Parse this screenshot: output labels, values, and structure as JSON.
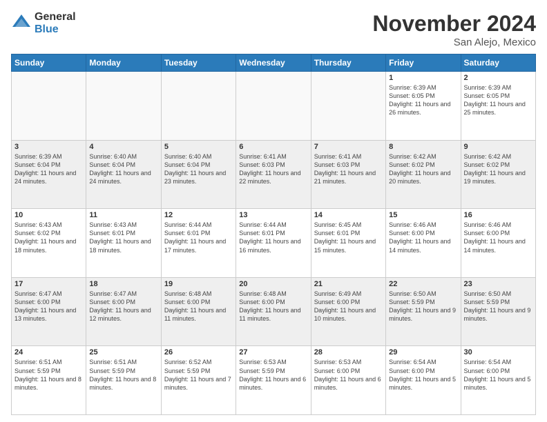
{
  "logo": {
    "general": "General",
    "blue": "Blue"
  },
  "title": {
    "month": "November 2024",
    "location": "San Alejo, Mexico"
  },
  "headers": [
    "Sunday",
    "Monday",
    "Tuesday",
    "Wednesday",
    "Thursday",
    "Friday",
    "Saturday"
  ],
  "weeks": [
    [
      {
        "day": "",
        "info": "",
        "empty": true
      },
      {
        "day": "",
        "info": "",
        "empty": true
      },
      {
        "day": "",
        "info": "",
        "empty": true
      },
      {
        "day": "",
        "info": "",
        "empty": true
      },
      {
        "day": "",
        "info": "",
        "empty": true
      },
      {
        "day": "1",
        "info": "Sunrise: 6:39 AM\nSunset: 6:05 PM\nDaylight: 11 hours\nand 26 minutes.",
        "empty": false
      },
      {
        "day": "2",
        "info": "Sunrise: 6:39 AM\nSunset: 6:05 PM\nDaylight: 11 hours\nand 25 minutes.",
        "empty": false
      }
    ],
    [
      {
        "day": "3",
        "info": "Sunrise: 6:39 AM\nSunset: 6:04 PM\nDaylight: 11 hours\nand 24 minutes.",
        "empty": false
      },
      {
        "day": "4",
        "info": "Sunrise: 6:40 AM\nSunset: 6:04 PM\nDaylight: 11 hours\nand 24 minutes.",
        "empty": false
      },
      {
        "day": "5",
        "info": "Sunrise: 6:40 AM\nSunset: 6:04 PM\nDaylight: 11 hours\nand 23 minutes.",
        "empty": false
      },
      {
        "day": "6",
        "info": "Sunrise: 6:41 AM\nSunset: 6:03 PM\nDaylight: 11 hours\nand 22 minutes.",
        "empty": false
      },
      {
        "day": "7",
        "info": "Sunrise: 6:41 AM\nSunset: 6:03 PM\nDaylight: 11 hours\nand 21 minutes.",
        "empty": false
      },
      {
        "day": "8",
        "info": "Sunrise: 6:42 AM\nSunset: 6:02 PM\nDaylight: 11 hours\nand 20 minutes.",
        "empty": false
      },
      {
        "day": "9",
        "info": "Sunrise: 6:42 AM\nSunset: 6:02 PM\nDaylight: 11 hours\nand 19 minutes.",
        "empty": false
      }
    ],
    [
      {
        "day": "10",
        "info": "Sunrise: 6:43 AM\nSunset: 6:02 PM\nDaylight: 11 hours\nand 18 minutes.",
        "empty": false
      },
      {
        "day": "11",
        "info": "Sunrise: 6:43 AM\nSunset: 6:01 PM\nDaylight: 11 hours\nand 18 minutes.",
        "empty": false
      },
      {
        "day": "12",
        "info": "Sunrise: 6:44 AM\nSunset: 6:01 PM\nDaylight: 11 hours\nand 17 minutes.",
        "empty": false
      },
      {
        "day": "13",
        "info": "Sunrise: 6:44 AM\nSunset: 6:01 PM\nDaylight: 11 hours\nand 16 minutes.",
        "empty": false
      },
      {
        "day": "14",
        "info": "Sunrise: 6:45 AM\nSunset: 6:01 PM\nDaylight: 11 hours\nand 15 minutes.",
        "empty": false
      },
      {
        "day": "15",
        "info": "Sunrise: 6:46 AM\nSunset: 6:00 PM\nDaylight: 11 hours\nand 14 minutes.",
        "empty": false
      },
      {
        "day": "16",
        "info": "Sunrise: 6:46 AM\nSunset: 6:00 PM\nDaylight: 11 hours\nand 14 minutes.",
        "empty": false
      }
    ],
    [
      {
        "day": "17",
        "info": "Sunrise: 6:47 AM\nSunset: 6:00 PM\nDaylight: 11 hours\nand 13 minutes.",
        "empty": false
      },
      {
        "day": "18",
        "info": "Sunrise: 6:47 AM\nSunset: 6:00 PM\nDaylight: 11 hours\nand 12 minutes.",
        "empty": false
      },
      {
        "day": "19",
        "info": "Sunrise: 6:48 AM\nSunset: 6:00 PM\nDaylight: 11 hours\nand 11 minutes.",
        "empty": false
      },
      {
        "day": "20",
        "info": "Sunrise: 6:48 AM\nSunset: 6:00 PM\nDaylight: 11 hours\nand 11 minutes.",
        "empty": false
      },
      {
        "day": "21",
        "info": "Sunrise: 6:49 AM\nSunset: 6:00 PM\nDaylight: 11 hours\nand 10 minutes.",
        "empty": false
      },
      {
        "day": "22",
        "info": "Sunrise: 6:50 AM\nSunset: 5:59 PM\nDaylight: 11 hours\nand 9 minutes.",
        "empty": false
      },
      {
        "day": "23",
        "info": "Sunrise: 6:50 AM\nSunset: 5:59 PM\nDaylight: 11 hours\nand 9 minutes.",
        "empty": false
      }
    ],
    [
      {
        "day": "24",
        "info": "Sunrise: 6:51 AM\nSunset: 5:59 PM\nDaylight: 11 hours\nand 8 minutes.",
        "empty": false
      },
      {
        "day": "25",
        "info": "Sunrise: 6:51 AM\nSunset: 5:59 PM\nDaylight: 11 hours\nand 8 minutes.",
        "empty": false
      },
      {
        "day": "26",
        "info": "Sunrise: 6:52 AM\nSunset: 5:59 PM\nDaylight: 11 hours\nand 7 minutes.",
        "empty": false
      },
      {
        "day": "27",
        "info": "Sunrise: 6:53 AM\nSunset: 5:59 PM\nDaylight: 11 hours\nand 6 minutes.",
        "empty": false
      },
      {
        "day": "28",
        "info": "Sunrise: 6:53 AM\nSunset: 6:00 PM\nDaylight: 11 hours\nand 6 minutes.",
        "empty": false
      },
      {
        "day": "29",
        "info": "Sunrise: 6:54 AM\nSunset: 6:00 PM\nDaylight: 11 hours\nand 5 minutes.",
        "empty": false
      },
      {
        "day": "30",
        "info": "Sunrise: 6:54 AM\nSunset: 6:00 PM\nDaylight: 11 hours\nand 5 minutes.",
        "empty": false
      }
    ]
  ]
}
